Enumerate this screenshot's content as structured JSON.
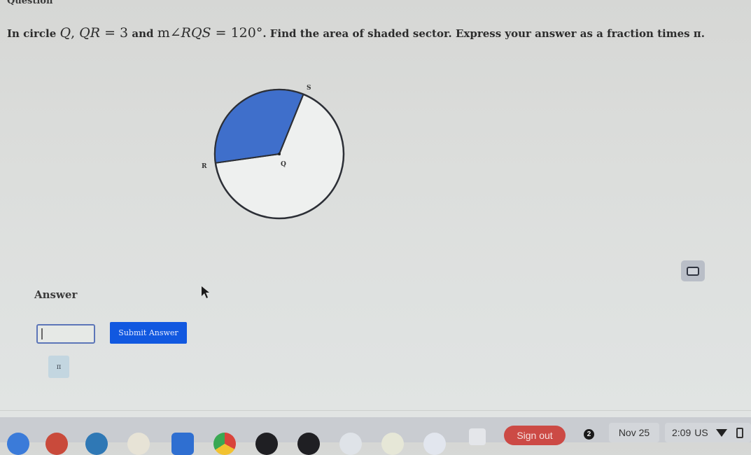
{
  "header": {
    "label": "Question"
  },
  "question": {
    "prefix": "In circle ",
    "circle_name": "Q",
    "sep": ", ",
    "segment": "QR",
    "eq1": " = ",
    "radius": "3",
    "and": " and ",
    "m": "m",
    "angle": "∠RQS",
    "eq2": " = ",
    "degrees": "120°",
    "suffix": ". Find the area of shaded sector. Express your answer as a fraction times π."
  },
  "figure": {
    "labels": {
      "S": "S",
      "R": "R",
      "Q": "Q"
    },
    "sector_color": "#3f6fcb",
    "radius_value": 3,
    "central_angle_deg": 120
  },
  "answer": {
    "label": "Answer",
    "input_value": "",
    "submit_label": "Submit Answer",
    "pi_button_label": "π"
  },
  "taskbar": {
    "sign_out_label": "Sign out",
    "notification_count": "2",
    "date": "Nov 25",
    "time": "2:09",
    "locale": "US"
  }
}
